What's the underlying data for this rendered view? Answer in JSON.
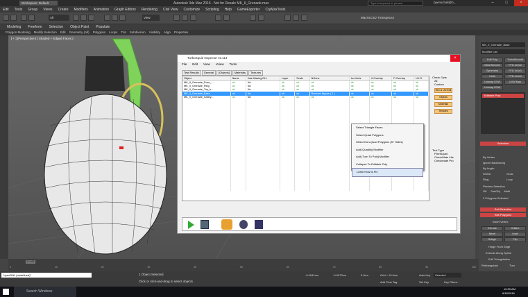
{
  "app": {
    "title": "Autodesk 3ds Max 2016 - Not for Resale   MK_II_Grenade.max",
    "workspace": "Workspace: Default",
    "search_placeholder": "Type a keyword or phrase",
    "user": "bpenschall@b..."
  },
  "menu": [
    "Edit",
    "Tools",
    "Group",
    "Views",
    "Create",
    "Modifiers",
    "Animation",
    "Graph Editors",
    "Rendering",
    "Civil View",
    "Customize",
    "Scripting",
    "Help",
    "GameExporter",
    "CryMaxTools"
  ],
  "toolbar": {
    "filter": "All",
    "view": "View",
    "plugins": "MaxToCSD TSInspector"
  },
  "ribbon": {
    "tabs": [
      "Modeling",
      "Freeform",
      "Selection",
      "Object Paint",
      "Populate"
    ],
    "sub": [
      "Polygon Modeling",
      "Modify Selection",
      "Edit",
      "Geometry (All)",
      "Polygons",
      "Loops",
      "Tris",
      "Subdivision",
      "Visibility",
      "Align",
      "Properties"
    ]
  },
  "viewport": {
    "label": "[ + ] [Perspective ] [ Shaded + Edged Faces ]"
  },
  "inspector": {
    "title": "TurboSquid Inspector v2.114",
    "menu": [
      "File",
      "Edit",
      "View",
      "xView",
      "Tools"
    ],
    "tabs": [
      "Test Results",
      "General",
      "[Objects]",
      "Materials",
      "Textures"
    ],
    "columns": [
      "Object",
      "Name",
      "Has Missing DLL",
      "Layer",
      "Scale",
      "NGons",
      "Iso.Verts",
      "X-Overlap",
      "F-Overlap",
      "UV-O"
    ],
    "rows": [
      {
        "cells": [
          "MK_II_Grenade_Fuse_...",
          "ok",
          "No",
          "ok",
          "ok",
          "ok",
          "ok",
          "ok",
          "ok",
          "ok"
        ],
        "selected": false
      },
      {
        "cells": [
          "MK_II_Grenade_Ring",
          "ok",
          "No",
          "ok",
          "ok",
          "ok",
          "ok",
          "ok",
          "ok",
          "ok"
        ],
        "selected": false
      },
      {
        "cells": [
          "MK_II_Grenade_Top_b...",
          "ok",
          "No",
          "ok",
          "ok",
          "ok",
          "ok",
          "ok",
          "ok",
          "ok"
        ],
        "selected": false
      },
      {
        "cells": [
          "MK_II_Grenade_Base",
          "ok",
          "No",
          "ok",
          "ok",
          "Remove Ngons ( 2 )",
          "ok",
          "ok",
          "ok",
          "ok"
        ],
        "selected": true
      },
      {
        "cells": [
          "MK_II_Grenade_Safety...",
          "ok",
          "No",
          "ok",
          "ok",
          "ok",
          "ok",
          "ok",
          "ok",
          "ok"
        ],
        "selected": false
      }
    ],
    "context_menu": [
      "Select Triangle Faces",
      "Select Quad Polygons",
      "Select Non-Quad Polygons (5+ Sides)",
      "Add [Quadify] Modifier",
      "Add [Turn To Poly] Modifier",
      "Collapse To Editable Poly",
      "Learn How to Fix"
    ],
    "check_opts": {
      "title": "Check Opts",
      "options": [
        "All",
        "Custom"
      ],
      "buttons": [
        "Rev & Uni Edit",
        "Objects",
        "Materials",
        "Textures"
      ]
    },
    "text_type": {
      "title": "Text Type",
      "options": [
        "PixelSquid",
        "CheckMate Lite",
        "Checkmate Pro"
      ]
    }
  },
  "command_panel": {
    "object_name": "MK_II_Grenade_Base",
    "modifier_list": "Modifier List",
    "buttons": [
      "Edit Poly",
      "TurboSmooth",
      "MeshSmooth",
      "FFD 2x2x2",
      "Symmetry",
      "FFD 3x3x3",
      "Cloth",
      "FFD 4x4x4",
      "Unwrap UVW",
      "UVW Map",
      "Unwrap UVW"
    ],
    "stack_item": "Editable Poly",
    "selection_title": "Selection",
    "by_vertex": "By Vertex",
    "ignore_backfacing": "Ignore Backfacing",
    "by_angle": "By Angle:",
    "shrink": "Shrink",
    "grow": "Grow",
    "ring": "Ring",
    "loop": "Loop",
    "preview_selection": "Preview Selection",
    "preview_opts": [
      "Off",
      "SubObj",
      "Multi"
    ],
    "poly_selected": "2 Polygons Selected",
    "soft_selection": "Soft Selection",
    "edit_polygons": "Edit Polygons",
    "insert_vertex": "Insert Vertex",
    "edit_buttons": [
      "Extrude",
      "Outline",
      "Bevel",
      "Inset",
      "Bridge",
      "Flip"
    ],
    "hinge": "Hinge From Edge",
    "extrude_spline": "Extrude Along Spline",
    "edit_triangulation": "Edit Triangulation",
    "retriangulate": "Retriangulate",
    "turn": "Turn"
  },
  "timeline": {
    "frame": "0 / 100",
    "ticks": [
      "0",
      "10",
      "20",
      "30",
      "40",
      "50",
      "60",
      "70",
      "80",
      "90",
      "100"
    ]
  },
  "status": {
    "script": "\"openDNL (undefined)\"",
    "selected": "1 Object Selected",
    "prompt": "Click or click-and-drag to select objects",
    "x": "-0.0041cm",
    "y": "-0.0073cm",
    "z": "0.0cm",
    "grid": "Grid = 10.0cm",
    "autokey": "Auto Key",
    "selected_dd": "Selected",
    "setkey": "Set Key",
    "keyfilters": "Key Filters...",
    "add_time_tag": "Add Time Tag"
  },
  "taskbar": {
    "search": "Search Windows",
    "time": "10:39 AM",
    "date": "6/18/2016"
  }
}
